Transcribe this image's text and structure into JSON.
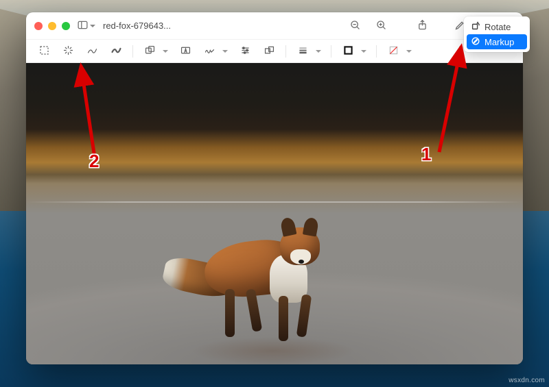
{
  "window": {
    "title": "red-fox-679643..."
  },
  "titlebar": {
    "sidebar_icon": "sidebar-icon",
    "zoom_out_icon": "zoom-out-icon",
    "zoom_in_icon": "zoom-in-icon",
    "share_icon": "share-icon",
    "highlight_icon": "highlight-icon",
    "search_icon": "search-icon",
    "overflow_icon": "chevron-double-right-icon"
  },
  "markup_toolbar": {
    "items": [
      "selection-icon",
      "instant-alpha-icon",
      "sketch-icon",
      "draw-icon",
      "shapes-icon",
      "text-icon",
      "sign-icon",
      "adjust-color-icon",
      "adjust-size-icon",
      "line-style-icon",
      "border-color-icon",
      "fill-color-icon"
    ]
  },
  "popup": {
    "items": [
      {
        "icon": "rotate-icon",
        "label": "Rotate",
        "selected": false
      },
      {
        "icon": "markup-icon",
        "label": "Markup",
        "selected": true
      }
    ]
  },
  "annotations": {
    "arrow1_number": "1",
    "arrow2_number": "2"
  },
  "colors": {
    "accent": "#0a7aff",
    "annotation_red": "#d80000"
  },
  "watermark": "wsxdn.com"
}
